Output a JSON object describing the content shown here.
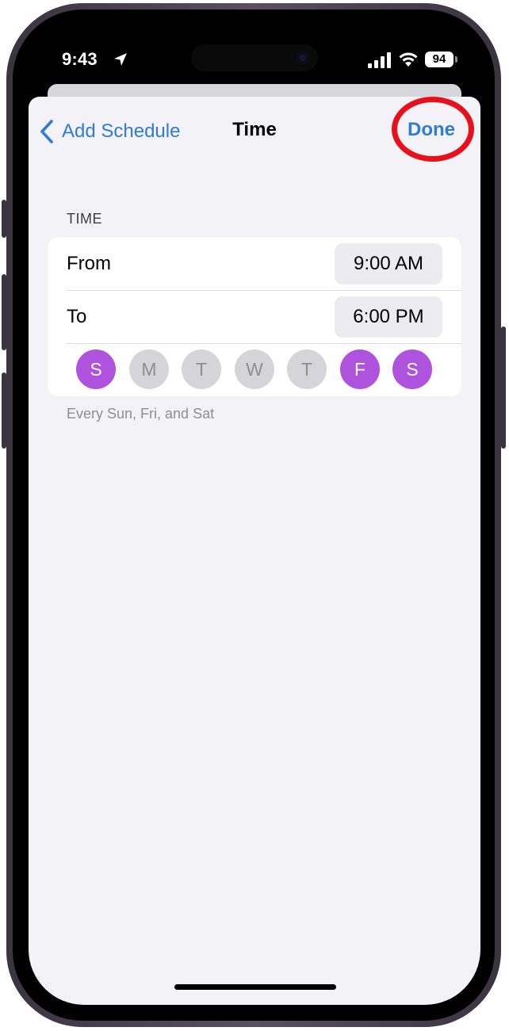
{
  "status_bar": {
    "time": "9:43",
    "battery": "94",
    "icons": [
      "location-icon",
      "signal-icon",
      "wifi-icon",
      "battery-icon"
    ]
  },
  "nav": {
    "back_label": "Add Schedule",
    "title": "Time",
    "done_label": "Done",
    "icons": [
      "chevron-left-icon"
    ]
  },
  "section": {
    "header": "TIME",
    "rows": [
      {
        "label": "From",
        "value": "9:00 AM"
      },
      {
        "label": "To",
        "value": "6:00 PM"
      }
    ],
    "days": [
      {
        "letter": "S",
        "selected": true
      },
      {
        "letter": "M",
        "selected": false
      },
      {
        "letter": "T",
        "selected": false
      },
      {
        "letter": "W",
        "selected": false
      },
      {
        "letter": "T",
        "selected": false
      },
      {
        "letter": "F",
        "selected": true
      },
      {
        "letter": "S",
        "selected": true
      }
    ],
    "footer": "Every Sun, Fri, and Sat"
  },
  "colors": {
    "accent": "#2f7bd8",
    "day_selected": "#af52de",
    "day_unselected": "#d4d4d9",
    "highlight": "#e8101a",
    "background": "#f2f2f7"
  }
}
